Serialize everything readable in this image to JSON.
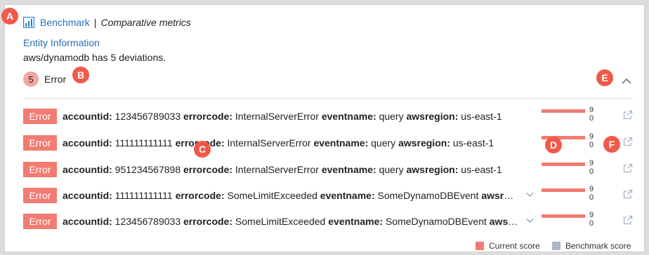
{
  "header": {
    "icon": "bar-chart-icon",
    "title": "Benchmark",
    "separator": "|",
    "subtitle": "Comparative metrics"
  },
  "entity": {
    "title": "Entity Information",
    "description": "aws/dynamodb has 5 deviations."
  },
  "group": {
    "count": "5",
    "label": "Error",
    "collapse_icon": "chevron-up-icon"
  },
  "rows": [
    {
      "severity": "Error",
      "fields": [
        {
          "key": "accountid:",
          "value": "123456789033"
        },
        {
          "key": "errorcode:",
          "value": "InternalServerError"
        },
        {
          "key": "eventname:",
          "value": "query"
        },
        {
          "key": "awsregion:",
          "value": "us-east-1"
        }
      ],
      "expandable": false,
      "current_score": "9",
      "benchmark_score": "0"
    },
    {
      "severity": "Error",
      "fields": [
        {
          "key": "accountid:",
          "value": "111111111111"
        },
        {
          "key": "errorcode:",
          "value": "InternalServerError"
        },
        {
          "key": "eventname:",
          "value": "query"
        },
        {
          "key": "awsregion:",
          "value": "us-east-1"
        }
      ],
      "expandable": false,
      "current_score": "9",
      "benchmark_score": "0"
    },
    {
      "severity": "Error",
      "fields": [
        {
          "key": "accountid:",
          "value": "951234567898"
        },
        {
          "key": "errorcode:",
          "value": "InternalServerError"
        },
        {
          "key": "eventname:",
          "value": "query"
        },
        {
          "key": "awsregion:",
          "value": "us-east-1"
        }
      ],
      "expandable": false,
      "current_score": "9",
      "benchmark_score": "0"
    },
    {
      "severity": "Error",
      "fields": [
        {
          "key": "accountid:",
          "value": "111111111111"
        },
        {
          "key": "errorcode:",
          "value": "SomeLimitExceeded"
        },
        {
          "key": "eventname:",
          "value": "SomeDynamoDBEvent"
        },
        {
          "key": "awsregion:",
          "value": "..."
        }
      ],
      "expandable": true,
      "current_score": "9",
      "benchmark_score": "0"
    },
    {
      "severity": "Error",
      "fields": [
        {
          "key": "accountid:",
          "value": "123456789033"
        },
        {
          "key": "errorcode:",
          "value": "SomeLimitExceeded"
        },
        {
          "key": "eventname:",
          "value": "SomeDynamoDBEvent"
        },
        {
          "key": "awsregi...",
          "value": ""
        }
      ],
      "expandable": true,
      "current_score": "9",
      "benchmark_score": "0"
    }
  ],
  "score_scale_max": 9,
  "legend": {
    "current": "Current score",
    "benchmark": "Benchmark score"
  },
  "callouts": [
    "A",
    "B",
    "C",
    "D",
    "E",
    "F"
  ],
  "colors": {
    "accent": "#2b6fb6",
    "current": "#f27b72",
    "benchmark": "#a9b8c7",
    "callout": "#f15a4b"
  }
}
